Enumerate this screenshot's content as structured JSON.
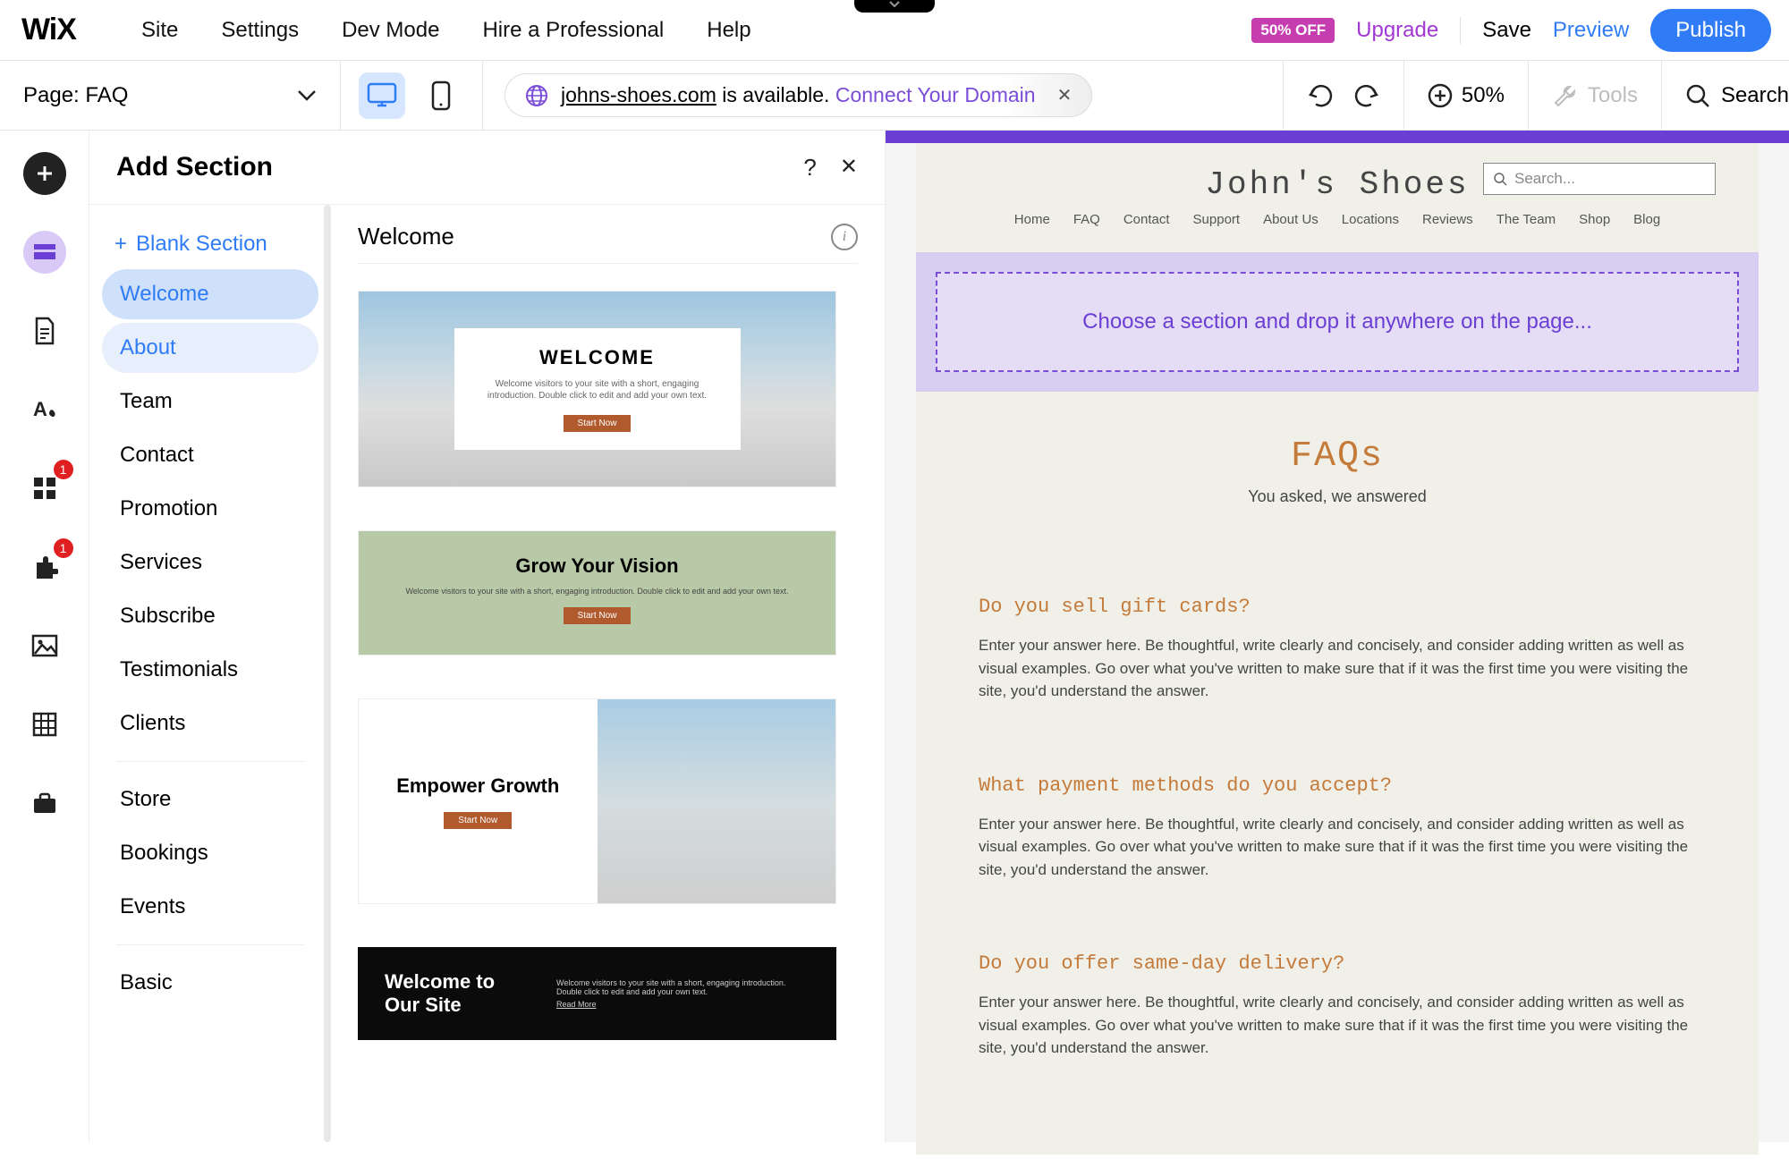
{
  "topbar": {
    "logo": "WIX",
    "menu": [
      "Site",
      "Settings",
      "Dev Mode",
      "Hire a Professional",
      "Help"
    ],
    "badge": "50% OFF",
    "upgrade": "Upgrade",
    "save": "Save",
    "preview": "Preview",
    "publish": "Publish"
  },
  "toolbar": {
    "page_label": "Page: FAQ",
    "domain_name": "johns-shoes.com",
    "domain_suffix": " is available. ",
    "connect": "Connect Your Domain",
    "zoom": "50%",
    "tools": "Tools",
    "search": "Search"
  },
  "leftrail": {
    "badges": {
      "apps": "1",
      "addons": "1"
    }
  },
  "panel": {
    "title": "Add Section",
    "blank": "Blank Section",
    "categories": [
      "Welcome",
      "About",
      "Team",
      "Contact",
      "Promotion",
      "Services",
      "Subscribe",
      "Testimonials",
      "Clients"
    ],
    "categories2": [
      "Store",
      "Bookings",
      "Events"
    ],
    "categories3": [
      "Basic"
    ],
    "templates_heading": "Welcome",
    "t1": {
      "title": "WELCOME",
      "sub": "Welcome visitors to your site with a short, engaging introduction. Double click to edit and add your own text.",
      "btn": "Start Now"
    },
    "t2": {
      "title": "Grow Your Vision",
      "sub": "Welcome visitors to your site with a short, engaging introduction. Double click to edit and add your own text.",
      "btn": "Start Now"
    },
    "t3": {
      "title": "Empower Growth",
      "btn": "Start Now"
    },
    "t4": {
      "title": "Welcome to Our Site",
      "sub": "Welcome visitors to your site with a short, engaging introduction. Double click to edit and add your own text.",
      "more": "Read More"
    }
  },
  "site": {
    "title": "John's Shoes",
    "search_placeholder": "Search...",
    "nav": [
      "Home",
      "FAQ",
      "Contact",
      "Support",
      "About Us",
      "Locations",
      "Reviews",
      "The Team",
      "Shop",
      "Blog"
    ],
    "dropzone": "Choose a section and drop it anywhere on the page...",
    "faq_title": "FAQs",
    "faq_sub": "You asked, we answered",
    "items": [
      {
        "q": "Do you sell gift cards?",
        "a": "Enter your answer here. Be thoughtful, write clearly and concisely, and consider adding written as well as visual examples. Go over what you've written to make sure that if it was the first time you were visiting the site, you'd understand the answer."
      },
      {
        "q": "What payment methods do you accept?",
        "a": "Enter your answer here. Be thoughtful, write clearly and concisely, and consider adding written as well as visual examples. Go over what you've written to make sure that if it was the first time you were visiting the site, you'd understand the answer."
      },
      {
        "q": "Do you offer same-day delivery?",
        "a": "Enter your answer here. Be thoughtful, write clearly and concisely, and consider adding written as well as visual examples. Go over what you've written to make sure that if it was the first time you were visiting the site, you'd understand the answer."
      }
    ]
  }
}
